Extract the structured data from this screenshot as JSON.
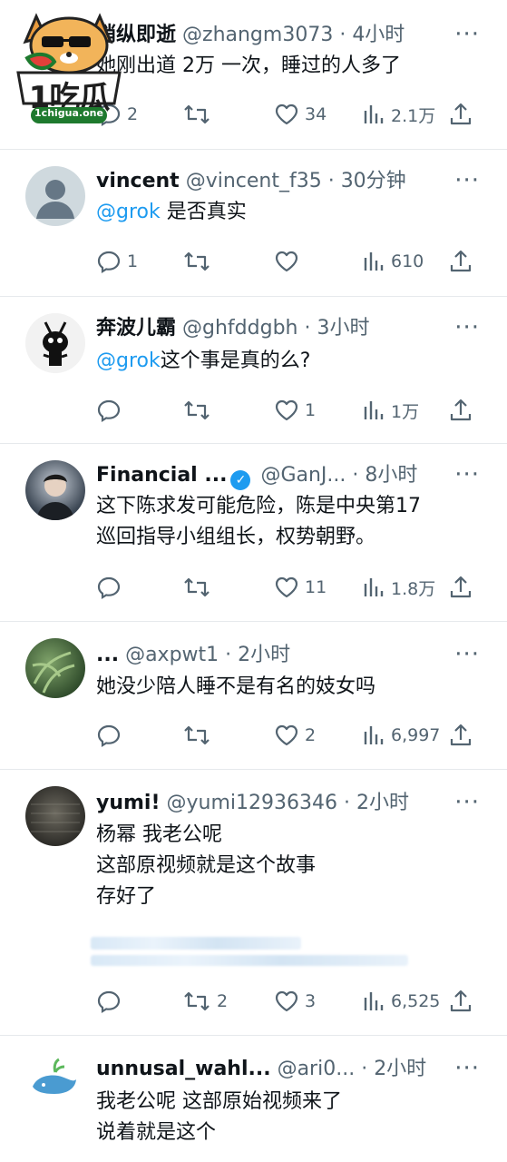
{
  "tweets": [
    {
      "name": "梢纵即逝",
      "handle": "@zhangm3073",
      "time": "· 4小时",
      "lines": [
        {
          "text": "她刚出道 2万 一次，睡过的人多了",
          "mention": ""
        }
      ],
      "replies": "2",
      "retweets": "",
      "likes": "34",
      "views": "2.1万"
    },
    {
      "name": "vincent",
      "handle": "@vincent_f35",
      "time": "· 30分钟",
      "lines": [
        {
          "mention": "@grok",
          "text": " 是否真实"
        }
      ],
      "replies": "1",
      "retweets": "",
      "likes": "",
      "views": "610"
    },
    {
      "name": "奔波儿霸",
      "handle": "@ghfddgbh",
      "time": "· 3小时",
      "lines": [
        {
          "mention": "@grok",
          "text": "这个事是真的么?"
        }
      ],
      "replies": "",
      "retweets": "",
      "likes": "1",
      "views": "1万"
    },
    {
      "name": "Financial ...",
      "handle": "@GanJ...",
      "time": "· 8小时",
      "verified": true,
      "lines": [
        {
          "mention": "",
          "text": "这下陈求发可能危险，陈是中央第17"
        },
        {
          "mention": "",
          "text": "巡回指导小组组长，权势朝野。"
        }
      ],
      "replies": "",
      "retweets": "",
      "likes": "11",
      "views": "1.8万"
    },
    {
      "name": "...",
      "handle": "@axpwt1",
      "time": "· 2小时",
      "lines": [
        {
          "mention": "",
          "text": "她没少陪人睡不是有名的妓女吗"
        }
      ],
      "replies": "",
      "retweets": "",
      "likes": "2",
      "views": "6,997"
    },
    {
      "name": "yumi!",
      "handle": "@yumi12936346",
      "time": "· 2小时",
      "lines": [
        {
          "mention": "",
          "text": "杨幂 我老公呢"
        },
        {
          "mention": "",
          "text": "这部原视频就是这个故事"
        },
        {
          "mention": "",
          "text": "存好了"
        }
      ],
      "replies": "",
      "retweets": "2",
      "likes": "3",
      "views": "6,525"
    },
    {
      "name": "unnusal_wahl...",
      "handle": "@ari0...",
      "time": "· 2小时",
      "lines": [
        {
          "mention": "",
          "text": "我老公呢 这部原始视频来了"
        },
        {
          "mention": "",
          "text": "说着就是这个"
        }
      ]
    }
  ],
  "watermark": {
    "main": "1吃瓜",
    "sub": "1chigua.one"
  },
  "more_glyph": "···",
  "colors": {
    "text": "#0f1419",
    "secondary": "#536471",
    "accent": "#1d9bf0",
    "divider": "#e6e9ec"
  }
}
